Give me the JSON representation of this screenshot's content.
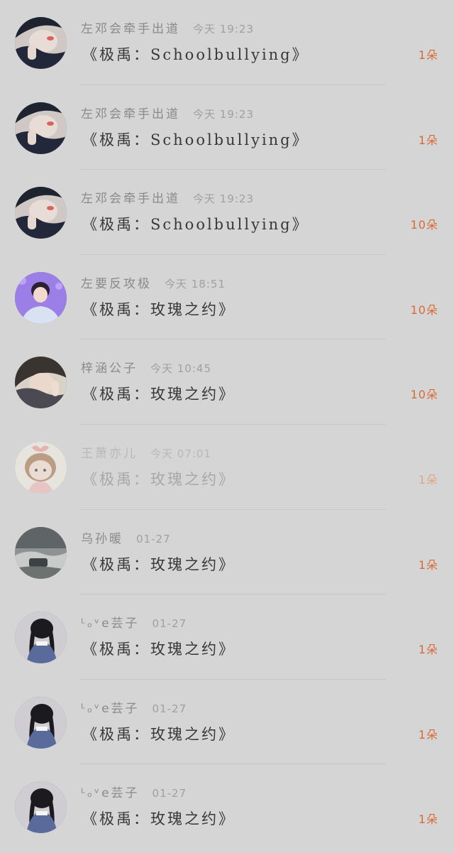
{
  "colors": {
    "background": "#d5d5d5",
    "count_accent": "#d86a35",
    "username": "#8a8a8a",
    "title": "#383838"
  },
  "items": [
    {
      "avatar": "avatar-dark-boy",
      "username": "左邓会牵手出道",
      "time": "今天 19:23",
      "title": "《极禹：Schoolbullying》",
      "count": "1朵",
      "faded": false
    },
    {
      "avatar": "avatar-dark-boy",
      "username": "左邓会牵手出道",
      "time": "今天 19:23",
      "title": "《极禹：Schoolbullying》",
      "count": "1朵",
      "faded": false
    },
    {
      "avatar": "avatar-dark-boy",
      "username": "左邓会牵手出道",
      "time": "今天 19:23",
      "title": "《极禹：Schoolbullying》",
      "count": "10朵",
      "faded": false
    },
    {
      "avatar": "avatar-purple-boy",
      "username": "左要反攻极",
      "time": "今天 18:51",
      "title": "《极禹：玫瑰之约》",
      "count": "10朵",
      "faded": false
    },
    {
      "avatar": "avatar-hand-face",
      "username": "梓涵公子",
      "time": "今天 10:45",
      "title": "《极禹：玫瑰之约》",
      "count": "10朵",
      "faded": false
    },
    {
      "avatar": "avatar-cartoon-girl",
      "username": "王萧亦儿",
      "time": "今天 07:01",
      "title": "《极禹：玫瑰之约》",
      "count": "1朵",
      "faded": true
    },
    {
      "avatar": "avatar-landscape",
      "username": "乌孙暖",
      "time": "01-27",
      "title": "《极禹：玫瑰之约》",
      "count": "1朵",
      "faded": false
    },
    {
      "avatar": "avatar-braid-girl",
      "username": "ᴸₒᵛe芸子",
      "time": "01-27",
      "title": "《极禹：玫瑰之约》",
      "count": "1朵",
      "faded": false
    },
    {
      "avatar": "avatar-braid-girl",
      "username": "ᴸₒᵛe芸子",
      "time": "01-27",
      "title": "《极禹：玫瑰之约》",
      "count": "1朵",
      "faded": false
    },
    {
      "avatar": "avatar-braid-girl",
      "username": "ᴸₒᵛe芸子",
      "time": "01-27",
      "title": "《极禹：玫瑰之约》",
      "count": "1朵",
      "faded": false
    }
  ]
}
